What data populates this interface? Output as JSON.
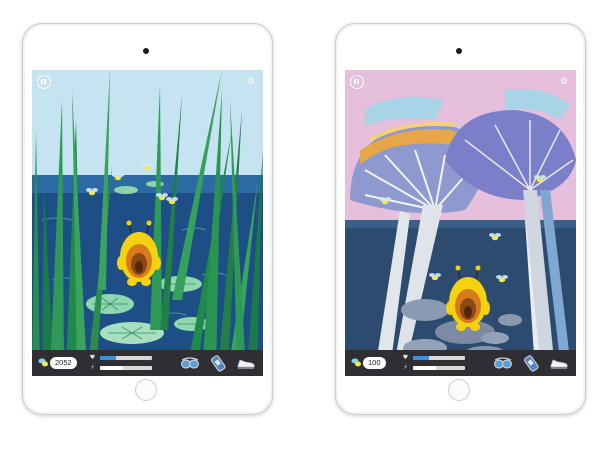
{
  "colors": {
    "hud_background": "#2f2f33",
    "health_fill": "#3d8fe0",
    "energy_fill": "#ffffff",
    "coin_color": "#8ad1f0"
  },
  "screens": [
    {
      "scene": "pond",
      "currency_icon": "firefly-coin-icon",
      "currency": "2052",
      "health_level": 0.3,
      "energy_level": 0.45,
      "tools": [
        "goggles-icon",
        "spray-can-icon",
        "shoe-icon"
      ]
    },
    {
      "scene": "mushrooms",
      "currency_icon": "firefly-coin-icon",
      "currency": "100",
      "health_level": 0.3,
      "energy_level": 0.45,
      "tools": [
        "goggles-icon",
        "spray-can-icon",
        "shoe-icon"
      ]
    }
  ]
}
